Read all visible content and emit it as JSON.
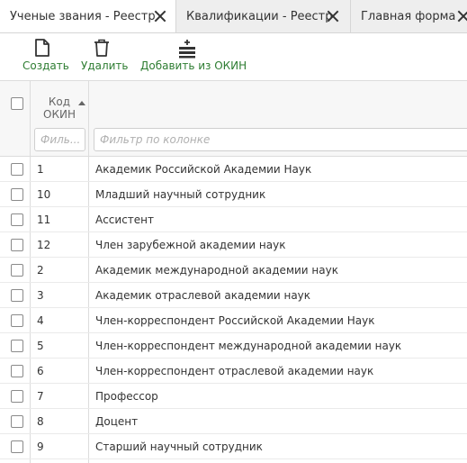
{
  "tabs": [
    {
      "label": "Ученые звания - Реестр"
    },
    {
      "label": "Квалификации - Реестр"
    },
    {
      "label": "Главная форма"
    }
  ],
  "toolbar": {
    "create_label": "Создать",
    "delete_label": "Удалить",
    "add_okin_label": "Добавить из ОКИН"
  },
  "grid": {
    "header_code_line1": "Код",
    "header_code_line2": "ОКИН",
    "filter_code_placeholder": "Филь...",
    "filter_name_placeholder": "Фильтр по колонке",
    "rows": [
      {
        "code": "1",
        "name": "Академик Российской Академии Наук"
      },
      {
        "code": "10",
        "name": "Младший научный сотрудник"
      },
      {
        "code": "11",
        "name": "Ассистент"
      },
      {
        "code": "12",
        "name": "Член зарубежной академии наук"
      },
      {
        "code": "2",
        "name": "Академик международной академии наук"
      },
      {
        "code": "3",
        "name": "Академик отраслевой академии наук"
      },
      {
        "code": "4",
        "name": "Член-корреспондент Российской Академии Наук"
      },
      {
        "code": "5",
        "name": "Член-корреспондент международной академии наук"
      },
      {
        "code": "6",
        "name": "Член-корреспондент отраслевой академии наук"
      },
      {
        "code": "7",
        "name": "Профессор"
      },
      {
        "code": "8",
        "name": "Доцент"
      },
      {
        "code": "9",
        "name": "Старший научный сотрудник"
      }
    ]
  },
  "colors": {
    "accent": "#2e7d32",
    "tab_bg": "#eeeeee"
  }
}
